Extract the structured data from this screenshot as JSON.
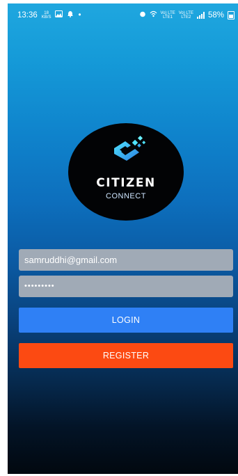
{
  "status_bar": {
    "time": "13:36",
    "speed_top": "18",
    "speed_bottom": "KB/S",
    "dot": "•",
    "net_top_1": "Vo) LTE",
    "net_bottom_1": "LTE1",
    "net_top_2": "Vo) LTE",
    "net_bottom_2": "LTE2",
    "battery": "58%"
  },
  "logo": {
    "title": "CITIZEN",
    "subtitle": "CONNECT"
  },
  "form": {
    "email_value": "samruddhi@gmail.com",
    "password_value": "•••••••••"
  },
  "buttons": {
    "login_label": "LOGIN",
    "register_label": "REGISTER"
  },
  "colors": {
    "login": "#2f80f5",
    "register": "#fc4a12",
    "input_bg": "#a0aab6"
  }
}
